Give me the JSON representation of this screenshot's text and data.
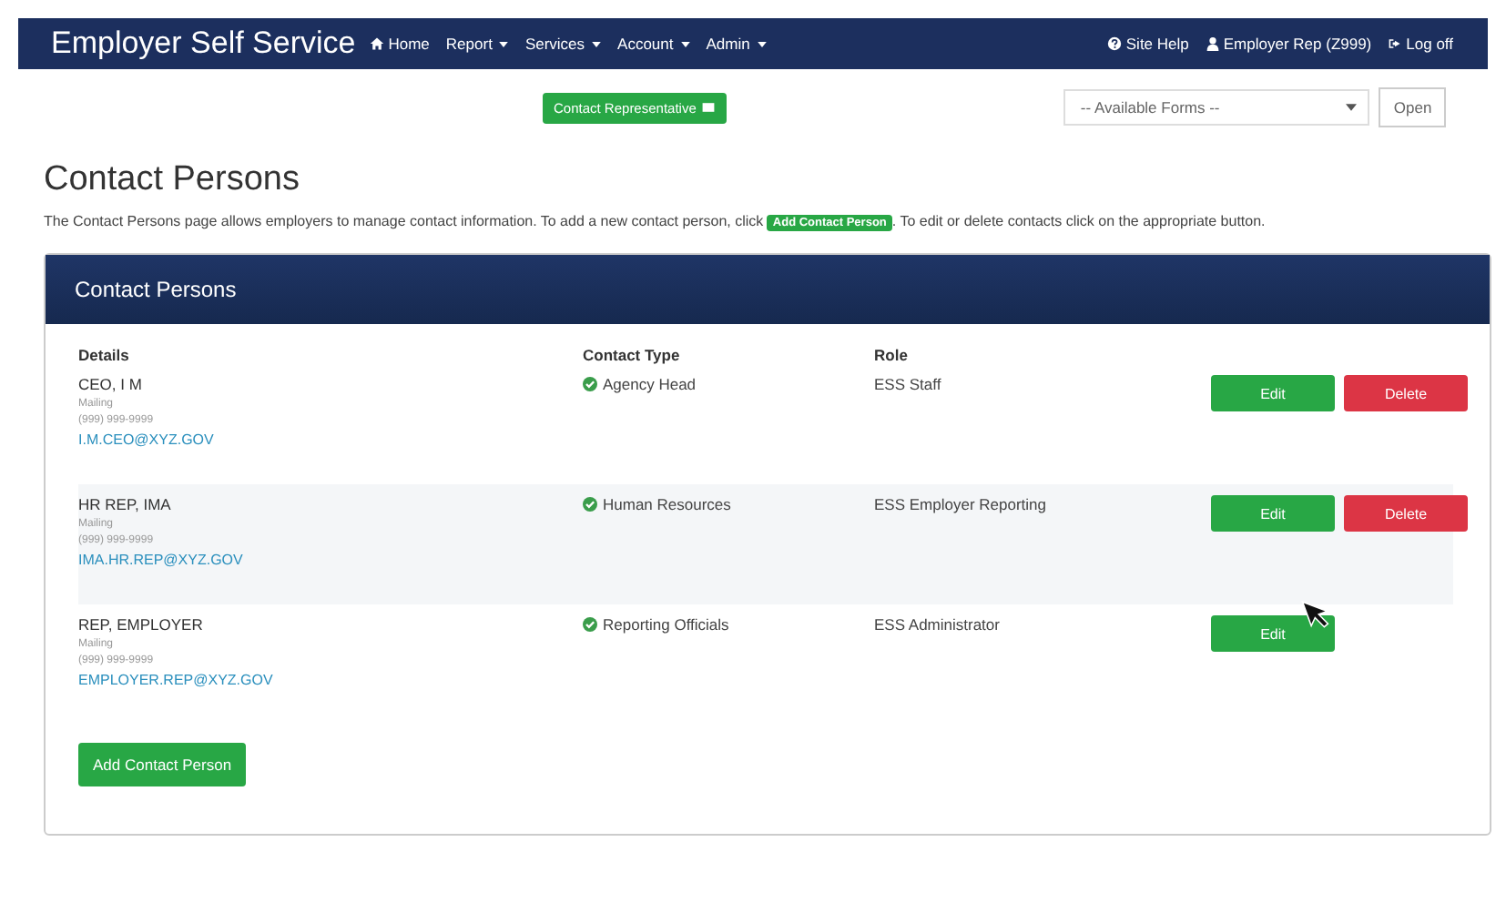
{
  "navbar": {
    "brand": "Employer Self Service",
    "items": [
      {
        "label": "Home",
        "kind": "home"
      },
      {
        "label": "Report",
        "kind": "menu"
      },
      {
        "label": "Services",
        "kind": "menu"
      },
      {
        "label": "Account",
        "kind": "menu"
      },
      {
        "label": "Admin",
        "kind": "menu"
      }
    ],
    "right": [
      {
        "label": "Site Help",
        "kind": "help"
      },
      {
        "label": "Employer Rep (Z999)",
        "kind": "user"
      },
      {
        "label": "Log off",
        "kind": "logout"
      }
    ]
  },
  "toolbar": {
    "contact_button": "Contact Representative",
    "forms_select": "-- Available Forms --",
    "open_button": "Open"
  },
  "page": {
    "title": "Contact Persons",
    "intro_before": "The Contact Persons page allows employers to manage contact information. To add a new contact person, click",
    "intro_badge": "Add Contact Person",
    "intro_after": ". To edit or delete contacts click on the appropriate button."
  },
  "panel": {
    "title": "Contact Persons",
    "columns": [
      "Details",
      "Contact Type",
      "Role"
    ],
    "rows": [
      {
        "name": "CEO, I M",
        "address": "Mailing",
        "phone": "(999) 999-9999",
        "email": "I.M.CEO@XYZ.GOV",
        "contact_type": "Agency Head",
        "role": "ESS Staff",
        "actions": [
          {
            "label": "Edit",
            "kind": "edit"
          },
          {
            "label": "Delete",
            "kind": "delete"
          }
        ]
      },
      {
        "name": "HR REP, IMA",
        "address": "Mailing",
        "phone": "(999) 999-9999",
        "email": "IMA.HR.REP@XYZ.GOV",
        "contact_type": "Human Resources",
        "role": "ESS Employer Reporting",
        "actions": [
          {
            "label": "Edit",
            "kind": "edit"
          },
          {
            "label": "Delete",
            "kind": "delete"
          }
        ]
      },
      {
        "name": "REP, EMPLOYER",
        "address": "Mailing",
        "phone": "(999) 999-9999",
        "email": "EMPLOYER.REP@XYZ.GOV",
        "contact_type": "Reporting Officials",
        "role": "ESS Administrator",
        "actions": [
          {
            "label": "Edit",
            "kind": "edit"
          }
        ]
      }
    ],
    "add_button": "Add Contact Person"
  }
}
